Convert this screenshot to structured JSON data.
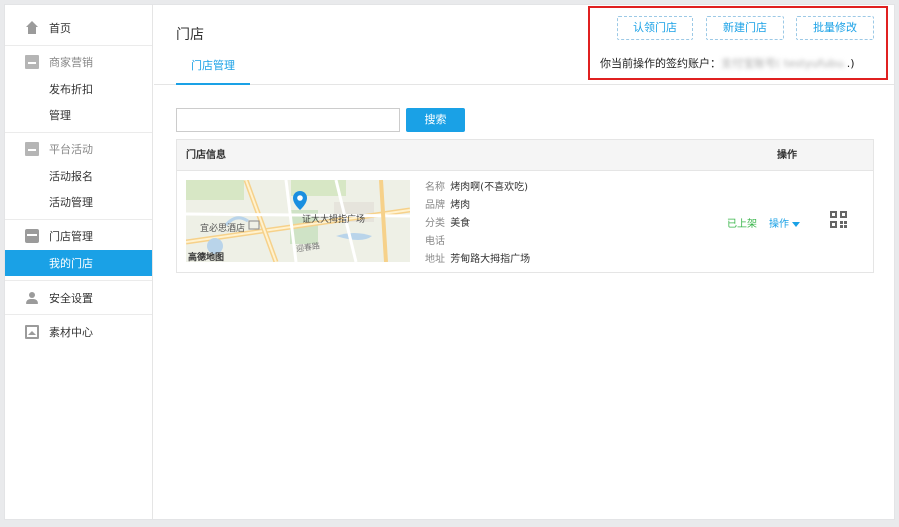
{
  "sidebar": {
    "home": "首页",
    "groups": [
      {
        "title": "商家营销",
        "icon": "box-icon",
        "items": [
          "发布折扣",
          "管理"
        ]
      },
      {
        "title": "平台活动",
        "icon": "box-icon",
        "items": [
          "活动报名",
          "活动管理"
        ]
      },
      {
        "title": "门店管理",
        "icon": "store-icon",
        "items": [
          "我的门店"
        ],
        "active_index": 0
      }
    ],
    "security": "安全设置",
    "materials": "素材中心"
  },
  "header": {
    "title": "门店",
    "tab": "门店管理",
    "buttons": {
      "claim": "认领门店",
      "create": "新建门店",
      "batch": "批量修改"
    },
    "account_label": "你当前操作的签约账户：",
    "account_value": "支付宝账号( testyufubu.",
    "account_close": ".)"
  },
  "search": {
    "placeholder": "",
    "button": "搜索"
  },
  "table": {
    "headers": {
      "info": "门店信息",
      "actions": "操作"
    },
    "rows": [
      {
        "map_labels": [
          "宜必思酒店",
          "证大大拇指广场",
          "迎春路",
          "高德地图"
        ],
        "fields": [
          {
            "key": "名称",
            "value": "烤肉啊(不喜欢吃)"
          },
          {
            "key": "品牌",
            "value": "烤肉"
          },
          {
            "key": "分类",
            "value": "美食"
          },
          {
            "key": "电话",
            "value": ""
          },
          {
            "key": "地址",
            "value": "芳甸路大拇指广场"
          }
        ],
        "status": "已上架",
        "operation": "操作"
      }
    ]
  },
  "colors": {
    "accent": "#1aa1e6",
    "status_green": "#39b54a",
    "highlight_red": "#e02020"
  }
}
